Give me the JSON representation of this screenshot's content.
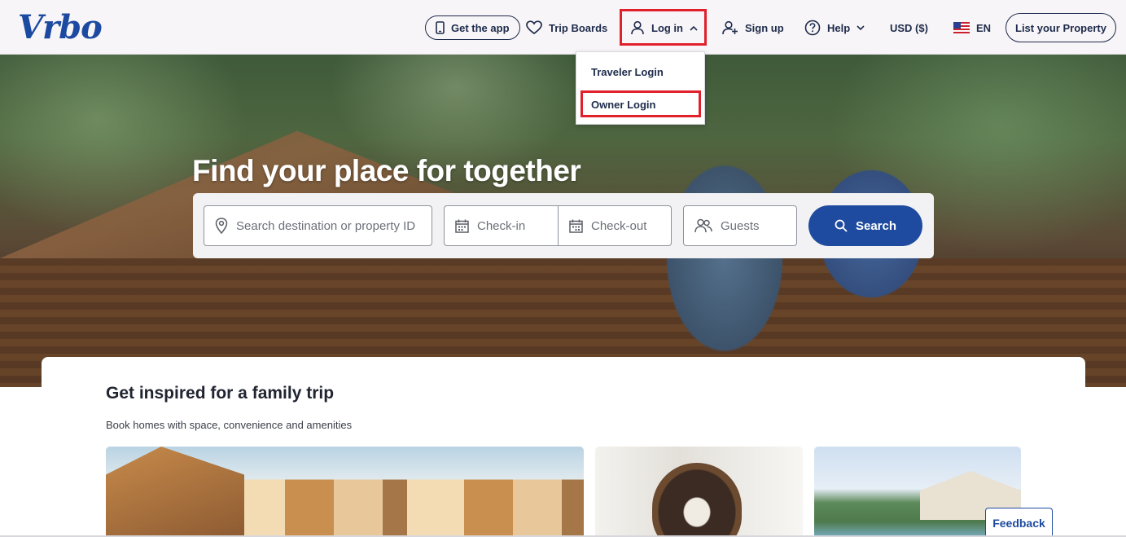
{
  "header": {
    "logo": "Vrbo",
    "get_app": "Get the app",
    "trip_boards": "Trip Boards",
    "login": "Log in",
    "signup": "Sign up",
    "help": "Help",
    "currency": "USD ($)",
    "language": "EN",
    "list_property": "List your Property"
  },
  "login_menu": {
    "items": [
      "Traveler Login",
      "Owner Login"
    ]
  },
  "hero": {
    "title": "Find your place for together"
  },
  "search": {
    "destination_placeholder": "Search destination or property ID",
    "checkin_placeholder": "Check-in",
    "checkout_placeholder": "Check-out",
    "guests_placeholder": "Guests",
    "button": "Search"
  },
  "inspire": {
    "title": "Get inspired for a family trip",
    "subtitle": "Book homes with space, convenience and amenities"
  },
  "feedback": "Feedback",
  "colors": {
    "brand": "#1e4ba0",
    "highlight": "#e0202a"
  }
}
